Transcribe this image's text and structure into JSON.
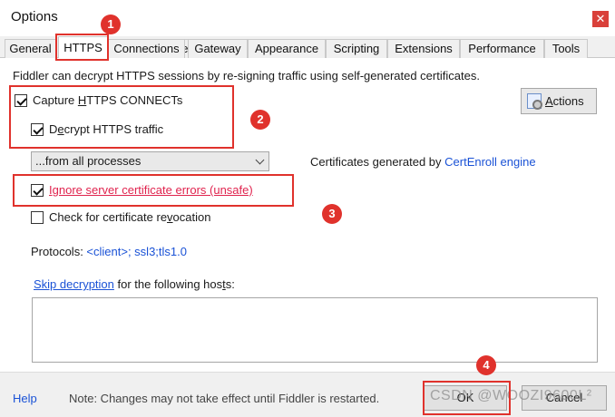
{
  "window": {
    "title": "Options",
    "close_glyph": "✕"
  },
  "tabs": [
    "General",
    "HTTPS",
    "Connections",
    "Gateway",
    "Appearance",
    "Scripting",
    "Extensions",
    "Performance",
    "Tools"
  ],
  "active_tab": "HTTPS",
  "intro": "Fiddler can decrypt HTTPS sessions by re-signing traffic using self-generated certificates.",
  "capture": {
    "pre": "Capture ",
    "key": "H",
    "post": "TTPS CONNECTs",
    "checked": true
  },
  "decrypt": {
    "pre": "D",
    "key": "e",
    "post": "crypt HTTPS traffic",
    "checked": true
  },
  "process_select": {
    "value": "...from all processes"
  },
  "certs": {
    "prefix": "Certificates generated by ",
    "engine": "CertEnroll engine"
  },
  "actions": {
    "key": "A",
    "rest": "ctions"
  },
  "ignore": {
    "key": "I",
    "post": "gnore server certificate errors (unsafe)",
    "checked": true
  },
  "revocation": {
    "pre": "Check for certificate re",
    "key": "v",
    "post": "ocation",
    "checked": false
  },
  "protocols": {
    "label": "Protocols: ",
    "value": "<client>; ssl3;tls1.0"
  },
  "skip": {
    "link": "Skip decryption",
    "middle": " for the following hos",
    "key": "t",
    "end": "s:"
  },
  "footer": {
    "help": "Help",
    "note": "Note: Changes may not take effect until Fiddler is restarted.",
    "ok": "OK",
    "cancel": "Cancel",
    "watermark": "CSDN @WOOZI9600L²"
  },
  "annotations": [
    "1",
    "2",
    "3",
    "4"
  ],
  "colors": {
    "annotation": "#e0322c",
    "link": "#1a52d6",
    "warning_text": "#e0234e"
  }
}
